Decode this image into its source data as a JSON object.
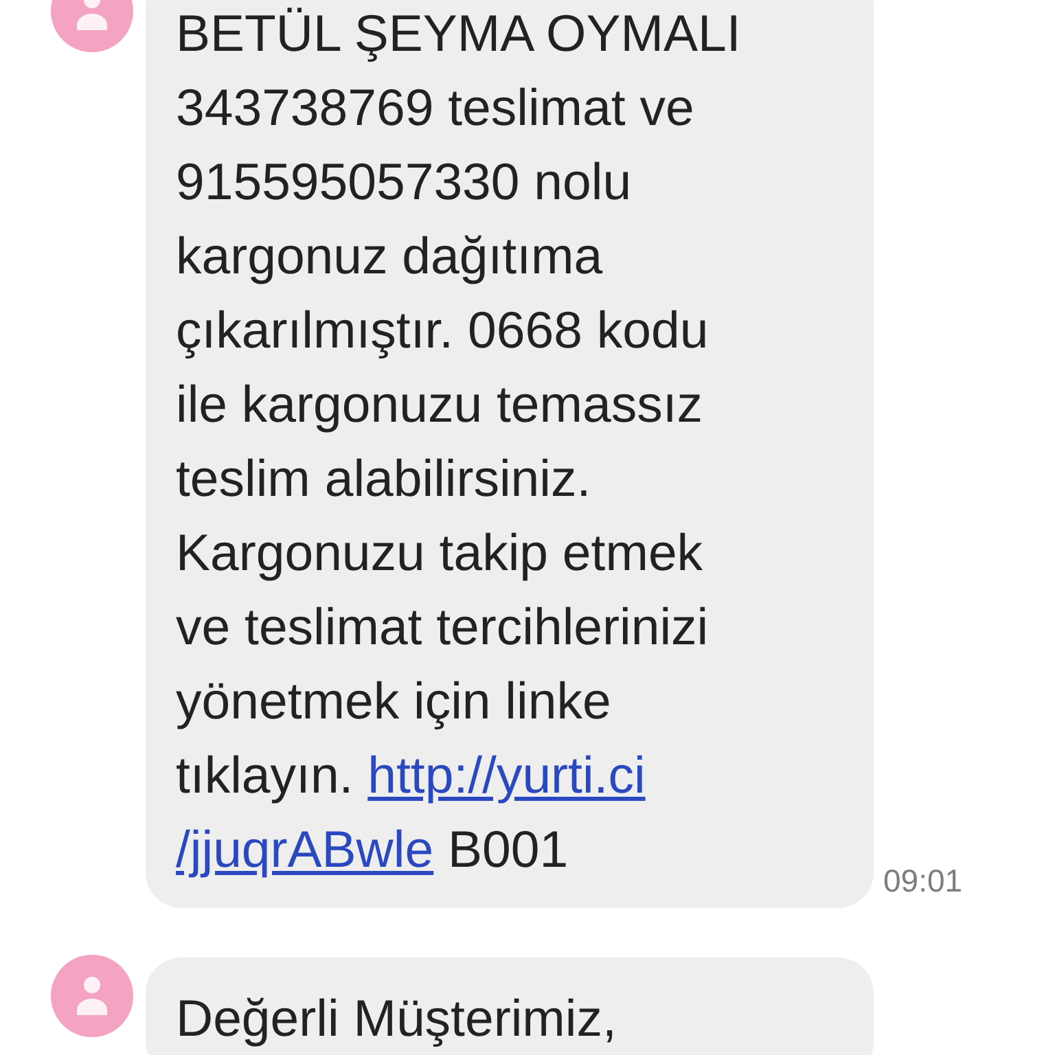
{
  "messages": [
    {
      "lines": [
        [
          {
            "kind": "text",
            "text": "BETÜL ŞEYMA OYMALI"
          }
        ],
        [
          {
            "kind": "text",
            "text": "343738769 teslimat ve"
          }
        ],
        [
          {
            "kind": "text",
            "text": "915595057330 nolu"
          }
        ],
        [
          {
            "kind": "text",
            "text": "kargonuz dağıtıma"
          }
        ],
        [
          {
            "kind": "text",
            "text": "çıkarılmıştır. 0668 kodu"
          }
        ],
        [
          {
            "kind": "text",
            "text": "ile kargonuzu temassız"
          }
        ],
        [
          {
            "kind": "text",
            "text": "teslim alabilirsiniz."
          }
        ],
        [
          {
            "kind": "text",
            "text": "Kargonuzu takip etmek"
          }
        ],
        [
          {
            "kind": "text",
            "text": "ve teslimat tercihlerinizi"
          }
        ],
        [
          {
            "kind": "text",
            "text": "yönetmek için linke"
          }
        ],
        [
          {
            "kind": "text",
            "text": "tıklayın. "
          },
          {
            "kind": "link",
            "text": "http://yurti.ci"
          }
        ],
        [
          {
            "kind": "link",
            "text": "/jjuqrABwle"
          },
          {
            "kind": "text",
            "text": " B001"
          }
        ]
      ],
      "time": "09:01"
    },
    {
      "lines": [
        [
          {
            "kind": "text",
            "text": "Değerli Müşterimiz,"
          }
        ]
      ]
    }
  ]
}
